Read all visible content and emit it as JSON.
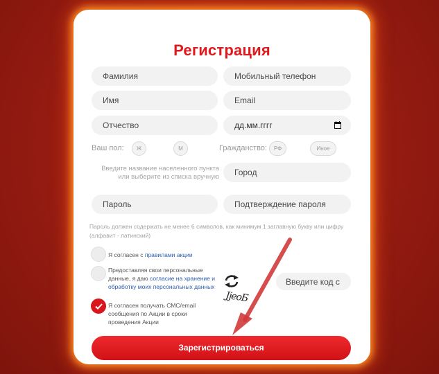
{
  "form": {
    "title": "Регистрация",
    "surname_placeholder": "Фамилия",
    "phone_placeholder": "Мобильный телефон",
    "name_placeholder": "Имя",
    "email_placeholder": "Email",
    "patronymic_placeholder": "Отчество",
    "birthdate_placeholder": "дд.мм.гггг",
    "gender_label": "Ваш пол:",
    "gender_options": [
      "Ж",
      "М"
    ],
    "citizenship_label": "Гражданство:",
    "citizenship_options": [
      "РФ",
      "Иное"
    ],
    "city_hint": "Введите название населенного пункта или выберите из списка вручную",
    "city_placeholder": "Город",
    "password_placeholder": "Пароль",
    "password_confirm_placeholder": "Подтверждение пароля",
    "password_note": "Пароль должен содержать не менее 6 символов, как минимум 1 заглавную букву или цифру (алфавит - латинский)",
    "agree_rules_prefix": "Я согласен с ",
    "agree_rules_link": "правилами акции",
    "agree_rules_checked": false,
    "agree_data_prefix": "Предоставляя свои персональные данные, я даю ",
    "agree_data_link": "согласие на хранение и обработку моих персональных данных",
    "agree_data_checked": false,
    "agree_sms_text": "Я согласен получать СМС/email сообщения по Акции в сроки проведения Акции",
    "agree_sms_checked": true,
    "captcha_text": "JjeoБ",
    "captcha_placeholder": "Введите код с картинки",
    "refresh_icon": "refresh-icon",
    "submit_label": "Зарегистрироваться"
  },
  "colors": {
    "accent": "#d9161b",
    "title": "#e0191d",
    "link": "#2a5db0",
    "background": "#9a1d12",
    "card_glow": "#ff9628"
  }
}
